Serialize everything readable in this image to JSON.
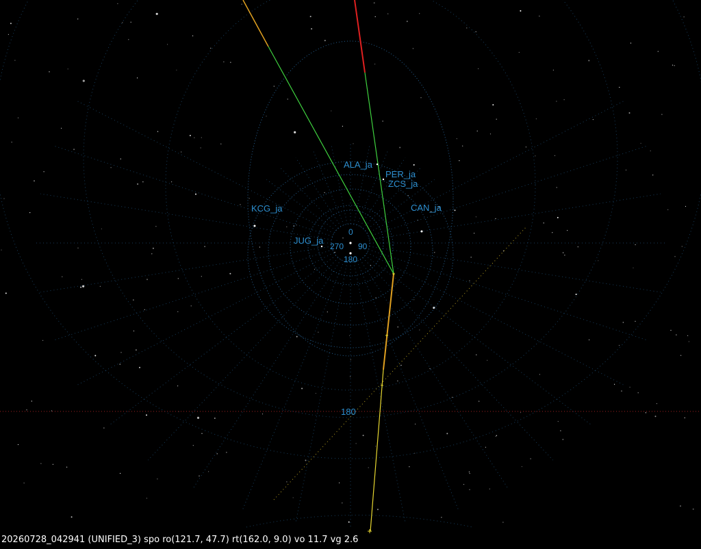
{
  "status_line": "20260728_042941 (UNIFIED_3) spo ro(121.7, 47.7) rt(162.0, 9.0) vo 11.7 vg 2.6",
  "stations": [
    {
      "name": "ALA_ja"
    },
    {
      "name": "PER_ja"
    },
    {
      "name": "ZCS_ja"
    },
    {
      "name": "KCG_ja"
    },
    {
      "name": "CAN_ja"
    },
    {
      "name": "JUG_ja"
    }
  ],
  "azimuth_labels": {
    "north": "0",
    "east": "90",
    "south": "180",
    "west": "270",
    "horizon_south": "180"
  },
  "colors": {
    "background": "#000000",
    "grid": "#2a6fa8",
    "label": "#2d8fd0",
    "trajectory_green": "#3fd23f",
    "trajectory_red": "#e02020",
    "trajectory_orange": "#e0a020",
    "trajectory_yellow": "#e8d830",
    "horizon_red": "#a02020"
  }
}
